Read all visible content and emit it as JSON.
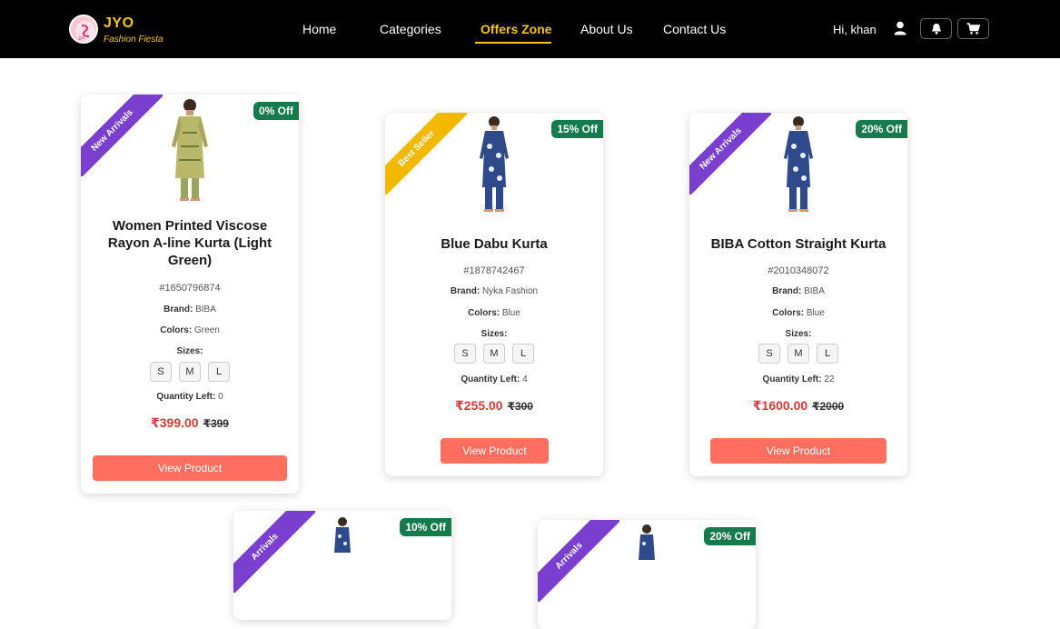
{
  "header": {
    "brand_name": "JYO",
    "brand_tagline": "Fashion Fiesta",
    "nav": [
      "Home",
      "Categories",
      "Offers Zone",
      "About Us",
      "Contact Us"
    ],
    "active_nav": "Offers Zone",
    "greeting": "Hi, khan",
    "accent_color": "#f5c518"
  },
  "labels": {
    "brand": "Brand:",
    "colors": "Colors:",
    "sizes": "Sizes:",
    "quantity": "Quantity Left:",
    "view_button": "View Product"
  },
  "products": [
    {
      "ribbon": "New Arrivals",
      "discount": "0% Off",
      "title": "Women Printed Viscose Rayon A-line Kurta (Light Green)",
      "sku": "#1650796874",
      "brand": "BIBA",
      "colors": "Green",
      "sizes": [
        "S",
        "M",
        "L"
      ],
      "quantity": "0",
      "price": "₹399.00",
      "old_price": "₹399"
    },
    {
      "ribbon": "Best Seller",
      "discount": "15% Off",
      "title": "Blue Dabu Kurta",
      "sku": "#1878742467",
      "brand": "Nyka Fashion",
      "colors": "Blue",
      "sizes": [
        "S",
        "M",
        "L"
      ],
      "quantity": "4",
      "price": "₹255.00",
      "old_price": "₹300"
    },
    {
      "ribbon": "New Arrivals",
      "discount": "20% Off",
      "title": "BIBA Cotton Straight Kurta",
      "sku": "#2010348072",
      "brand": "BIBA",
      "colors": "Blue",
      "sizes": [
        "S",
        "M",
        "L"
      ],
      "quantity": "22",
      "price": "₹1600.00",
      "old_price": "₹2000"
    },
    {
      "ribbon": "Arrivals",
      "discount": "10% Off"
    },
    {
      "ribbon": "Arrivals",
      "discount": "20% Off"
    }
  ]
}
